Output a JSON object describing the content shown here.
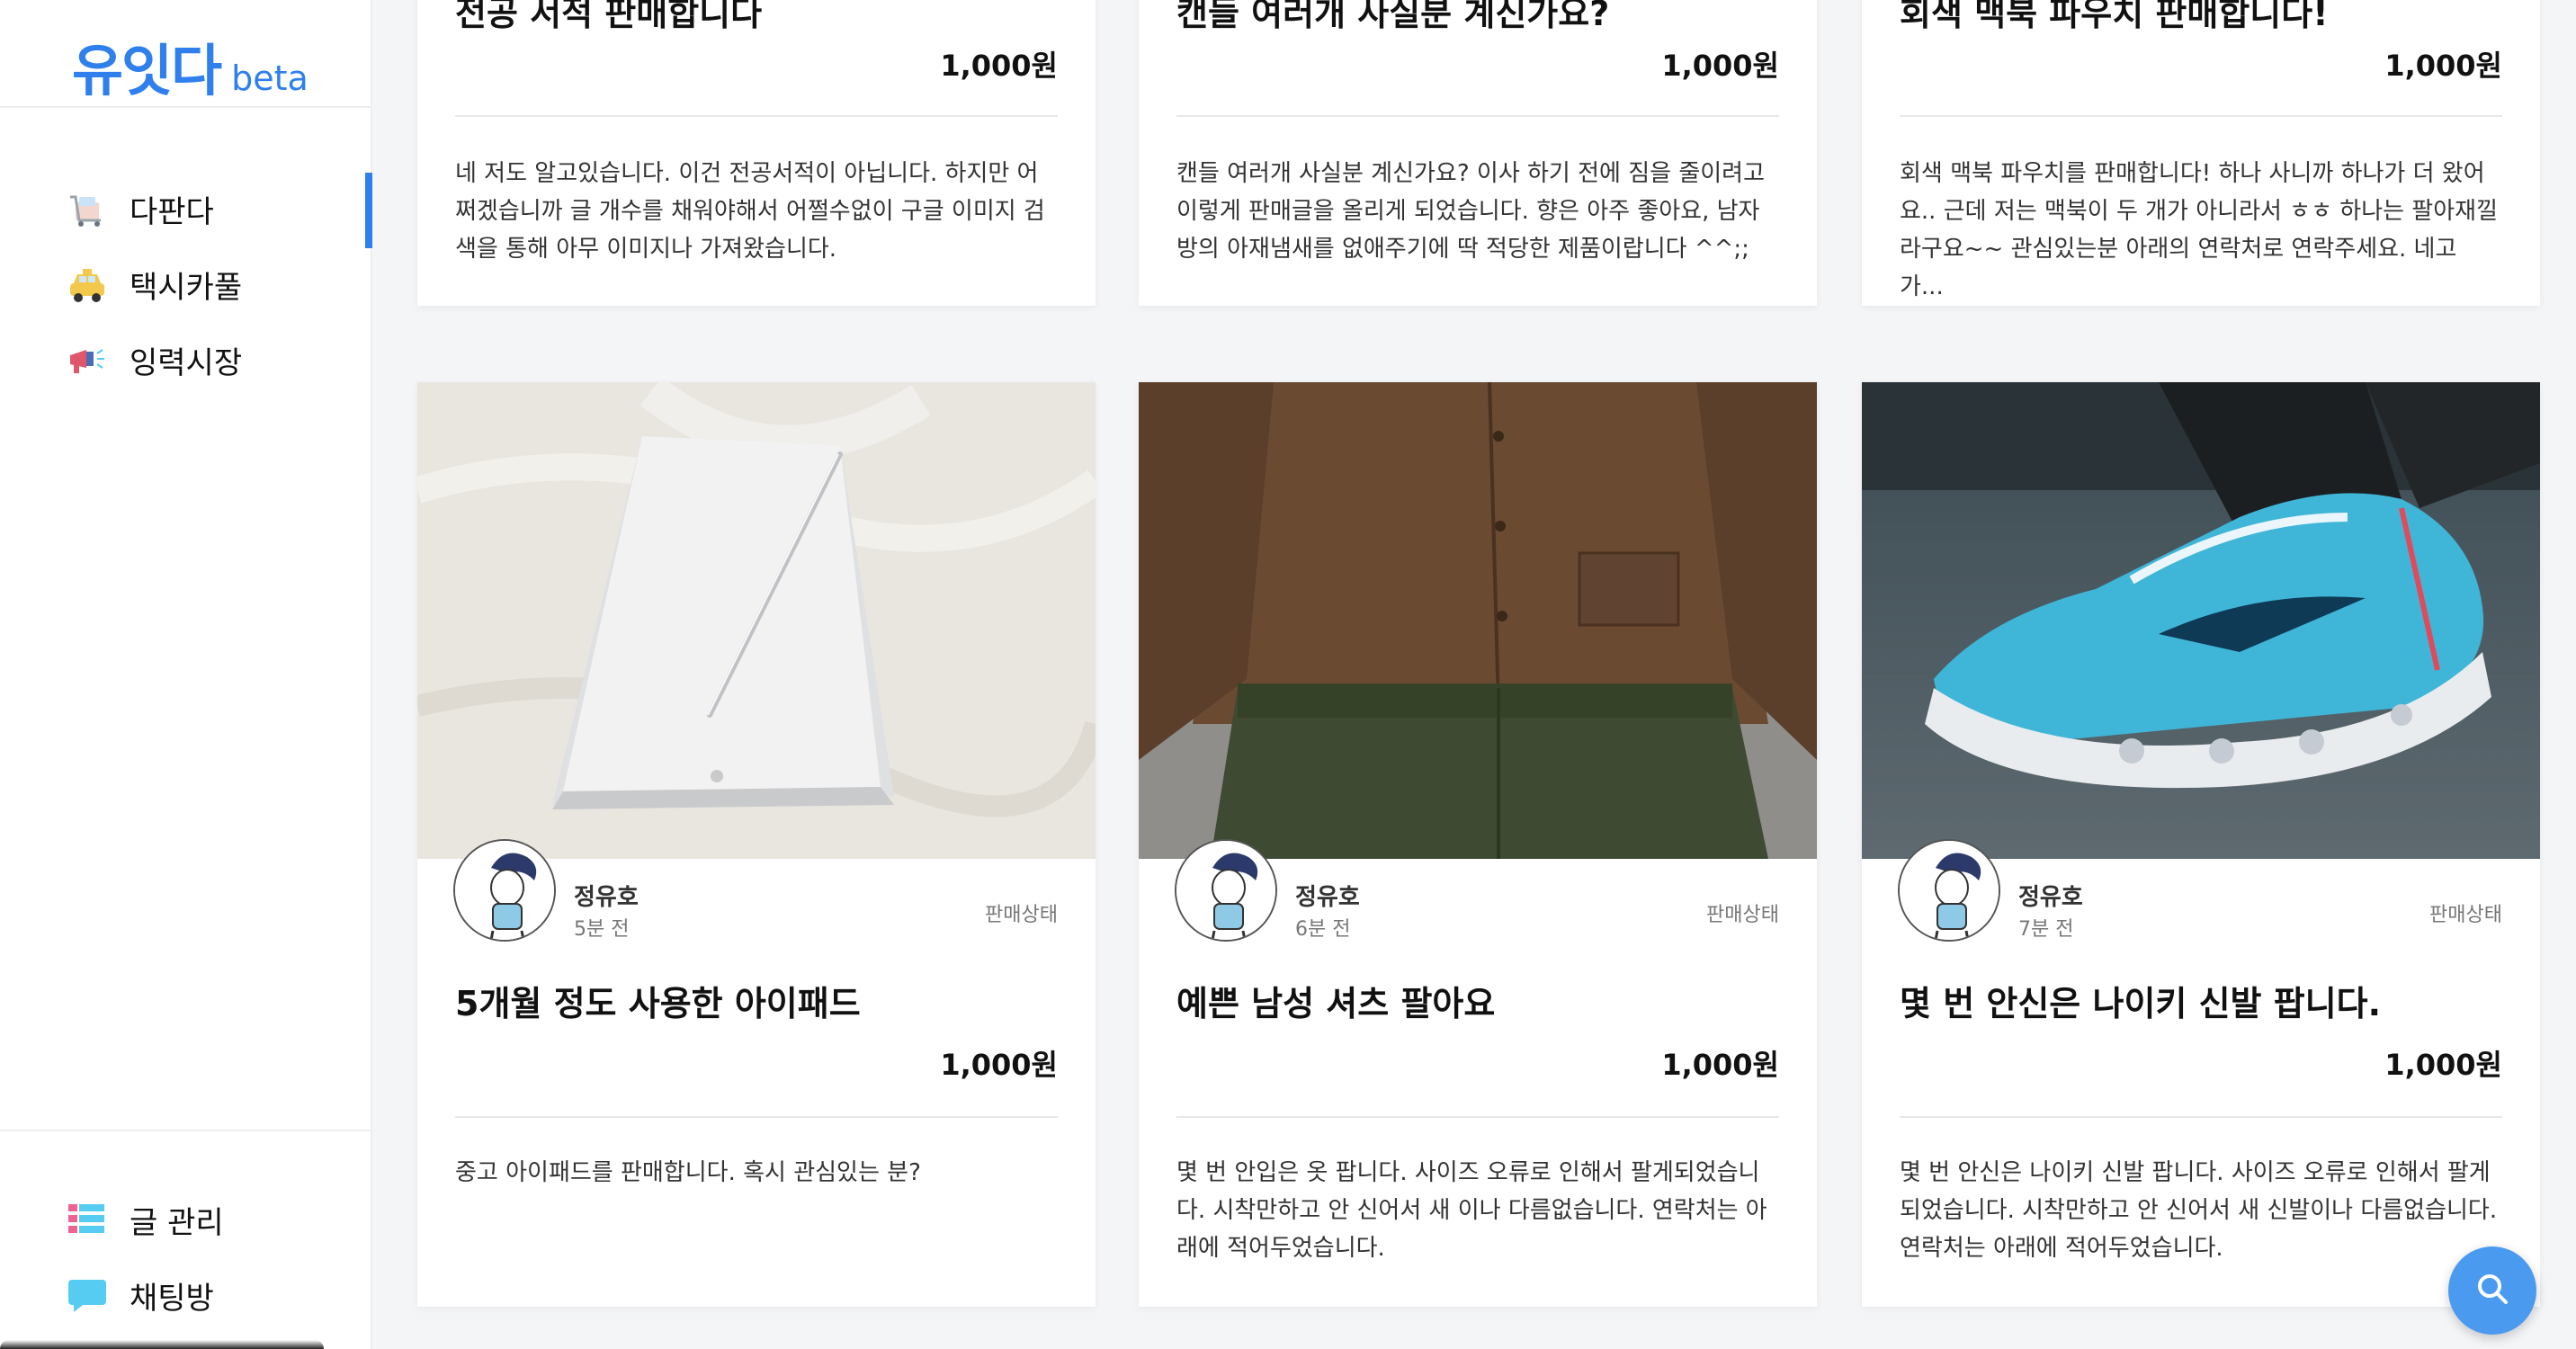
{
  "brand": {
    "name": "유잇다",
    "badge": "beta",
    "color": "#2f80ed"
  },
  "nav": {
    "items": [
      {
        "label": "다판다",
        "icon": "shopping-cart-icon",
        "active": true
      },
      {
        "label": "택시카풀",
        "icon": "taxi-icon",
        "active": false
      },
      {
        "label": "잉력시장",
        "icon": "megaphone-icon",
        "active": false
      }
    ],
    "bottom": [
      {
        "label": "글 관리",
        "icon": "list-icon"
      },
      {
        "label": "채팅방",
        "icon": "chat-bubble-icon"
      }
    ]
  },
  "top_row": [
    {
      "title": "전공 서적 판매합니다",
      "price": "1,000원",
      "description": "네 저도 알고있습니다. 이건 전공서적이 아닙니다. 하지만 어쩌겠습니까 글 개수를 채워야해서 어쩔수없이 구글 이미지 검색을 통해 아무 이미지나 가져왔습니다."
    },
    {
      "title": "캔들 여러개 사실분 계신가요?",
      "price": "1,000원",
      "description": "캔들 여러개 사실분 계신가요? 이사 하기 전에 짐을 줄이려고 이렇게 판매글을 올리게 되었습니다. 향은 아주 좋아요, 남자방의 아재냄새를 없애주기에 딱 적당한 제품이랍니다 ^^;;"
    },
    {
      "title": "회색 맥북 파우치 판매합니다!",
      "price": "1,000원",
      "description": "회색 맥북 파우치를 판매합니다! 하나 사니까 하나가 더 왔어요.. 근데 저는 맥북이 두 개가 아니라서 ㅎㅎ 하나는 팔아재낄라구요~~ 관심있는분 아래의 연락처로 연락주세요. 네고 가..."
    }
  ],
  "bottom_row": [
    {
      "photo": "ipad-box-photo",
      "seller": "정유호",
      "time": "5분 전",
      "status": "판매상태",
      "title": "5개월 정도 사용한 아이패드",
      "price": "1,000원",
      "description": "중고 아이패드를 판매합니다. 혹시 관심있는 분?"
    },
    {
      "photo": "brown-shirt-photo",
      "seller": "정유호",
      "time": "6분 전",
      "status": "판매상태",
      "title": "예쁜 남성 셔츠 팔아요",
      "price": "1,000원",
      "description": "몇 번 안입은 옷 팝니다. 사이즈 오류로 인해서 팔게되었습니다. 시착만하고 안 신어서 새 이나 다름없습니다. 연락처는 아래에 적어두었습니다."
    },
    {
      "photo": "blue-sneaker-photo",
      "seller": "정유호",
      "time": "7분 전",
      "status": "판매상태",
      "title": "몇 번 안신은 나이키 신발 팝니다.",
      "price": "1,000원",
      "description": "몇 번 안신은 나이키 신발 팝니다. 사이즈 오류로 인해서 팔게 되었습니다. 시착만하고 안 신어서 새 신발이나 다름없습니다. 연락처는 아래에 적어두었습니다."
    }
  ],
  "fab": {
    "icon": "search-icon",
    "color": "#4a9af0"
  }
}
